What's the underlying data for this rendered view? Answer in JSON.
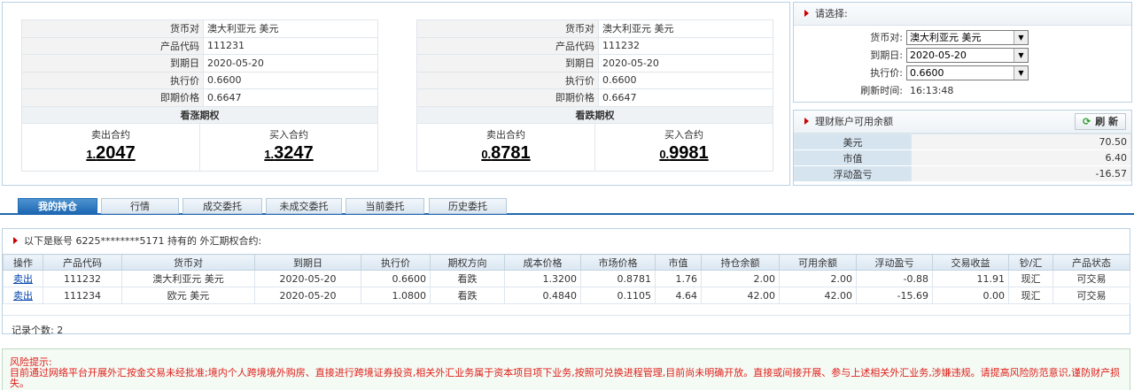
{
  "call_panel": {
    "rows": [
      {
        "label": "货币对",
        "value": "澳大利亚元 美元"
      },
      {
        "label": "产品代码",
        "value": "111231"
      },
      {
        "label": "到期日",
        "value": "2020-05-20"
      },
      {
        "label": "执行价",
        "value": "0.6600"
      },
      {
        "label": "即期价格",
        "value": "0.6647"
      }
    ],
    "title": "看涨期权",
    "sell_label": "卖出合约",
    "sell_small": "1.",
    "sell_big": "2047",
    "buy_label": "买入合约",
    "buy_small": "1.",
    "buy_big": "3247"
  },
  "put_panel": {
    "rows": [
      {
        "label": "货币对",
        "value": "澳大利亚元 美元"
      },
      {
        "label": "产品代码",
        "value": "111232"
      },
      {
        "label": "到期日",
        "value": "2020-05-20"
      },
      {
        "label": "执行价",
        "value": "0.6600"
      },
      {
        "label": "即期价格",
        "value": "0.6647"
      }
    ],
    "title": "看跌期权",
    "sell_label": "卖出合约",
    "sell_small": "0.",
    "sell_big": "8781",
    "buy_label": "买入合约",
    "buy_small": "0.",
    "buy_big": "9981"
  },
  "select_panel": {
    "title": "请选择:",
    "currency_label": "货币对:",
    "currency_value": "澳大利亚元 美元",
    "expiry_label": "到期日:",
    "expiry_value": "2020-05-20",
    "strike_label": "执行价:",
    "strike_value": "0.6600",
    "refresh_label": "刷新时间:",
    "refresh_value": "16:13:48"
  },
  "balance_panel": {
    "title": "理财账户可用余额",
    "refresh_button": "刷 新",
    "rows": [
      {
        "label": "美元",
        "value": "70.50"
      },
      {
        "label": "市值",
        "value": "6.40"
      },
      {
        "label": "浮动盈亏",
        "value": "-16.57"
      }
    ]
  },
  "tabs": [
    "我的持仓",
    "行情",
    "成交委托",
    "未成交委托",
    "当前委托",
    "历史委托"
  ],
  "holdings": {
    "caption": "以下是账号 6225********5171 持有的 外汇期权合约:",
    "columns": [
      "操作",
      "产品代码",
      "货币对",
      "到期日",
      "执行价",
      "期权方向",
      "成本价格",
      "市场价格",
      "市值",
      "持仓余额",
      "可用余额",
      "浮动盈亏",
      "交易收益",
      "钞/汇",
      "产品状态"
    ],
    "rows": [
      [
        "卖出",
        "111232",
        "澳大利亚元 美元",
        "2020-05-20",
        "0.6600",
        "看跌",
        "1.3200",
        "0.8781",
        "1.76",
        "2.00",
        "2.00",
        "-0.88",
        "11.91",
        "现汇",
        "可交易"
      ],
      [
        "卖出",
        "111234",
        "欧元 美元",
        "2020-05-20",
        "1.0800",
        "看跌",
        "0.4840",
        "0.1105",
        "4.64",
        "42.00",
        "42.00",
        "-15.69",
        "0.00",
        "现汇",
        "可交易"
      ]
    ],
    "count_label": "记录个数: ",
    "count": "2"
  },
  "risk": {
    "title": "风险提示:",
    "text": "目前通过网络平台开展外汇按金交易未经批准;境内个人跨境境外购房、直接进行跨境证券投资,相关外汇业务属于资本项目项下业务,按照可兑换进程管理,目前尚未明确开放。直接或间接开展、参与上述相关外汇业务,涉嫌违规。请提高风险防范意识,谨防财产损失。"
  },
  "colors": {
    "accent": "#1f69b3",
    "risk_text": "#e0201b",
    "link": "#0645ad"
  }
}
